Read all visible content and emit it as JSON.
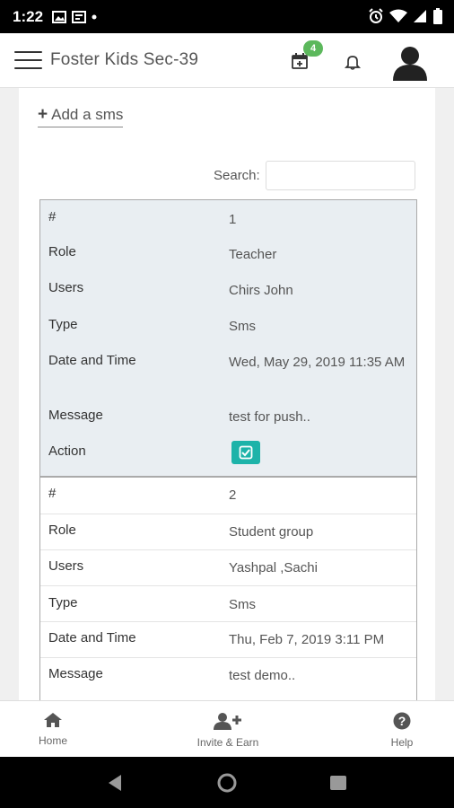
{
  "statusbar": {
    "time": "1:22"
  },
  "appbar": {
    "title": "Foster Kids Sec-39",
    "notification_count": "4"
  },
  "actions": {
    "add_label": "Add a sms"
  },
  "search": {
    "label": "Search:",
    "value": ""
  },
  "records": [
    {
      "fields": [
        {
          "label": "#",
          "value": "1"
        },
        {
          "label": "Role",
          "value": "Teacher"
        },
        {
          "label": "Users",
          "value": "Chirs John"
        },
        {
          "label": "Type",
          "value": "Sms"
        },
        {
          "label": "Date and Time",
          "value": "Wed, May 29, 2019 11:35 AM"
        },
        {
          "label": "Message",
          "value": "test for push.."
        },
        {
          "label": "Action",
          "value": ""
        }
      ]
    },
    {
      "fields": [
        {
          "label": "#",
          "value": "2"
        },
        {
          "label": "Role",
          "value": "Student group"
        },
        {
          "label": "Users",
          "value": "Yashpal ,Sachi"
        },
        {
          "label": "Type",
          "value": "Sms"
        },
        {
          "label": "Date and Time",
          "value": "Thu, Feb 7, 2019 3:11 PM"
        },
        {
          "label": "Message",
          "value": "test demo.."
        }
      ]
    }
  ],
  "bottom_nav": [
    {
      "label": "Home",
      "icon": "home-icon"
    },
    {
      "label": "Invite & Earn",
      "icon": "add-user-icon"
    },
    {
      "label": "Help",
      "icon": "help-icon"
    }
  ],
  "colors": {
    "accent": "#1db3a9",
    "badge": "#5cb85c",
    "record_highlight": "#e9eef2"
  }
}
